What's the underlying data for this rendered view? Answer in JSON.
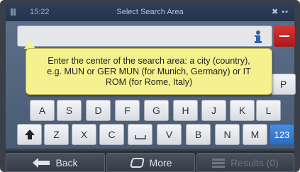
{
  "status_bar": {
    "time": "15:22",
    "title": "Select Search Area",
    "indicators": "✖ ••"
  },
  "search": {
    "value": "",
    "placeholder": ""
  },
  "tooltip": {
    "text": "Enter the center of the search area: a city (country), e.g. MUN or GER MUN (for Munich, Germany) or IT ROM (for Rome, Italy)"
  },
  "keyboard": {
    "row_top_partial": [
      "P"
    ],
    "row_middle": [
      "A",
      "S",
      "D",
      "F",
      "G",
      "H",
      "J",
      "K",
      "L"
    ],
    "row_bottom": [
      "Z",
      "X",
      "C",
      "V",
      "B",
      "N",
      "M"
    ],
    "numeric_toggle": "123"
  },
  "bottom_bar": {
    "back_label": "Back",
    "more_label": "More",
    "results_label": "Results (0)"
  },
  "colors": {
    "accent_blue": "#2a6bc0",
    "backspace_red": "#c62222",
    "tooltip_yellow": "#f4f18e"
  }
}
